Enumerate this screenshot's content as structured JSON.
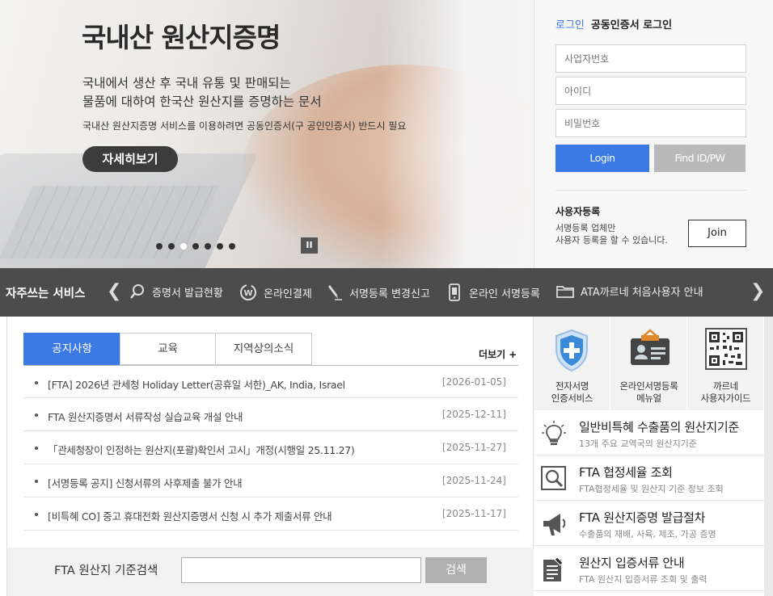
{
  "hero": {
    "title": "국내산 원산지증명",
    "desc_line1": "국내에서 생산 후 국내 유통 및 판매되는",
    "desc_line2": "물품에 대하여 한국산 원산지를 증명하는 문서",
    "note": "국내산 원산지증명 서비스를 이용하려면 공동인증서(구 공인인증서) 반드시 필요",
    "detail_button": "자세히보기",
    "slider": {
      "count": 7,
      "active_index": 2,
      "pause_label": "II"
    }
  },
  "login": {
    "tab_login": "로그인",
    "tab_cert": "공동인증서 로그인",
    "business_no_placeholder": "사업자번호",
    "id_placeholder": "아이디",
    "password_placeholder": "비밀번호",
    "login_button": "Login",
    "find_button": "Find ID/PW",
    "register_title": "사용자등록",
    "register_desc_line1": "서명등록 업체만",
    "register_desc_line2": "사용자 등록을 할 수 있습니다.",
    "join_button": "Join"
  },
  "services": {
    "title": "자주쓰는 서비스",
    "prev_icon": "chevron-left-icon",
    "next_icon": "chevron-right-icon",
    "items": [
      {
        "label": "증명서 발급현황",
        "icon": "search-icon"
      },
      {
        "label": "온라인결제",
        "icon": "won-coin-icon"
      },
      {
        "label": "서명등록 변경신고",
        "icon": "pen-icon"
      },
      {
        "label": "온라인 서명등록",
        "icon": "mobile-icon"
      },
      {
        "label": "ATA까르네 처음사용자 안내",
        "icon": "folder-icon"
      }
    ]
  },
  "notice": {
    "tabs": [
      "공지사항",
      "교육",
      "지역상의소식"
    ],
    "active_tab": 0,
    "more_label": "더보기 +",
    "items": [
      {
        "title": "[FTA] 2026년 관세청 Holiday Letter(공휴일 서한)_AK, India, Israel",
        "date": "[2026-01-05]"
      },
      {
        "title": "FTA 원산지증명서 서류작성 실습교육 개설 안내",
        "date": "[2025-12-11]"
      },
      {
        "title": "「관세청장이 인정하는 원산지(포괄)확인서 고시」개정(시행일 25.11.27)",
        "date": "[2025-11-27]"
      },
      {
        "title": "[서명등록 공지] 신청서류의 사후제출 불가 안내",
        "date": "[2025-11-24]"
      },
      {
        "title": "[비특혜 CO] 중고 휴대전화 원산지증명서 신청 시 추가 제출서류 안내",
        "date": "[2025-11-17]"
      }
    ]
  },
  "search": {
    "label": "FTA 원산지 기준검색",
    "value": "",
    "button": "검색"
  },
  "quick_menu": [
    {
      "line1": "전자서명",
      "line2": "인증서비스",
      "icon": "shield-plus-icon"
    },
    {
      "line1": "온라인서명등록",
      "line2": "메뉴얼",
      "icon": "id-card-icon"
    },
    {
      "line1": "까르네",
      "line2": "사용자가이드",
      "icon": "qr-code-icon"
    }
  ],
  "quick_links": [
    {
      "title": "일반비특혜 수출품의 원산지기준",
      "sub": "13개 주요 교역국의 원산지기준",
      "icon": "lightbulb-icon"
    },
    {
      "title": "FTA 협정세율 조회",
      "sub": "FTA협정세율 및 원산지 기준 정보 조회",
      "icon": "magnifier-icon"
    },
    {
      "title": "FTA 원산지증명 발급절차",
      "sub": "수출품의 재배, 사육, 제조, 가공 증명",
      "icon": "megaphone-icon"
    },
    {
      "title": "원산지 입증서류 안내",
      "sub": "FTA 원산지 입증서류 조회 및 출력",
      "icon": "document-pen-icon"
    }
  ],
  "colors": {
    "accent": "#3b7ae4",
    "bar": "#4c4c4c",
    "shield": "#3b8bd8"
  }
}
